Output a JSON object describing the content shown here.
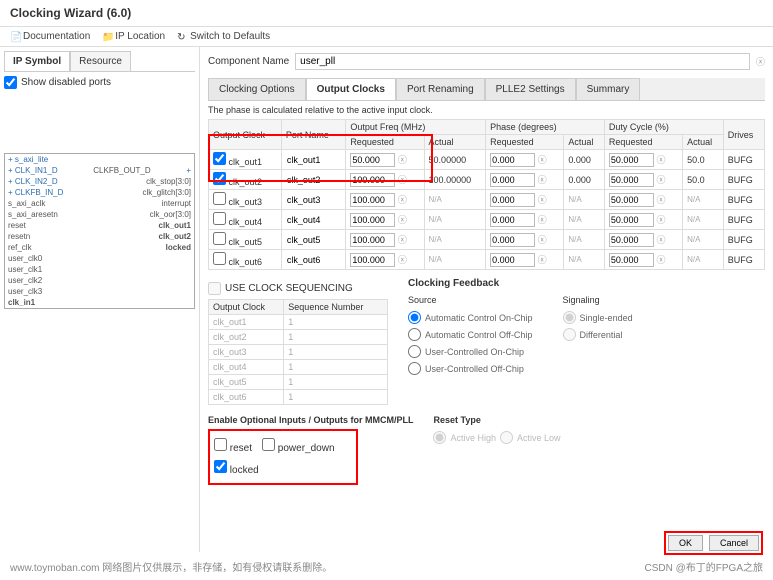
{
  "title": "Clocking Wizard (6.0)",
  "toolbar": {
    "doc": "Documentation",
    "iploc": "IP Location",
    "switch": "Switch to Defaults"
  },
  "left": {
    "tabs": {
      "ipsymbol": "IP Symbol",
      "resource": "Resource"
    },
    "show_disabled": "Show disabled ports",
    "diagram": {
      "left_ports": [
        "s_axi_lite",
        "CLK_IN1_D",
        "CLK_IN2_D",
        "CLKFB_IN_D",
        "s_axi_aclk",
        "s_axi_aresetn",
        "reset",
        "resetn",
        "ref_clk",
        "user_clk0",
        "user_clk1",
        "user_clk2",
        "user_clk3",
        "clk_in1"
      ],
      "right_ports": [
        "CLKFB_OUT_D",
        "clk_stop[3:0]",
        "clk_glitch[3:0]",
        "interrupt",
        "clk_oor[3:0]",
        "clk_out1",
        "clk_out2",
        "locked"
      ]
    }
  },
  "comp": {
    "label": "Component Name",
    "value": "user_pll"
  },
  "tabs": [
    "Clocking Options",
    "Output Clocks",
    "Port Renaming",
    "PLLE2 Settings",
    "Summary"
  ],
  "active_tab": 1,
  "note": "The phase is calculated relative to the active input clock.",
  "headers": {
    "oc": "Output Clock",
    "pn": "Port Name",
    "of": "Output Freq (MHz)",
    "req": "Requested",
    "act": "Actual",
    "ph": "Phase (degrees)",
    "dc": "Duty Cycle (%)",
    "drv": "Drives"
  },
  "rows": [
    {
      "en": true,
      "name": "clk_out1",
      "port": "clk_out1",
      "req": "50.000",
      "act": "50.00000",
      "preq": "0.000",
      "pact": "0.000",
      "dreq": "50.000",
      "dact": "50.0",
      "drv": "BUFG"
    },
    {
      "en": true,
      "name": "clk_out2",
      "port": "clk_out2",
      "req": "100.000",
      "act": "100.00000",
      "preq": "0.000",
      "pact": "0.000",
      "dreq": "50.000",
      "dact": "50.0",
      "drv": "BUFG"
    },
    {
      "en": false,
      "name": "clk_out3",
      "port": "clk_out3",
      "req": "100.000",
      "act": "N/A",
      "preq": "0.000",
      "pact": "N/A",
      "dreq": "50.000",
      "dact": "N/A",
      "drv": "BUFG"
    },
    {
      "en": false,
      "name": "clk_out4",
      "port": "clk_out4",
      "req": "100.000",
      "act": "N/A",
      "preq": "0.000",
      "pact": "N/A",
      "dreq": "50.000",
      "dact": "N/A",
      "drv": "BUFG"
    },
    {
      "en": false,
      "name": "clk_out5",
      "port": "clk_out5",
      "req": "100.000",
      "act": "N/A",
      "preq": "0.000",
      "pact": "N/A",
      "dreq": "50.000",
      "dact": "N/A",
      "drv": "BUFG"
    },
    {
      "en": false,
      "name": "clk_out6",
      "port": "clk_out6",
      "req": "100.000",
      "act": "N/A",
      "preq": "0.000",
      "pact": "N/A",
      "dreq": "50.000",
      "dact": "N/A",
      "drv": "BUFG"
    }
  ],
  "seq": {
    "use": "USE CLOCK SEQUENCING",
    "th": {
      "oc": "Output Clock",
      "sn": "Sequence Number"
    },
    "rows": [
      {
        "oc": "clk_out1",
        "sn": "1"
      },
      {
        "oc": "clk_out2",
        "sn": "1"
      },
      {
        "oc": "clk_out3",
        "sn": "1"
      },
      {
        "oc": "clk_out4",
        "sn": "1"
      },
      {
        "oc": "clk_out5",
        "sn": "1"
      },
      {
        "oc": "clk_out6",
        "sn": "1"
      }
    ]
  },
  "fb": {
    "title": "Clocking Feedback",
    "source": "Source",
    "signaling": "Signaling",
    "src_opts": [
      "Automatic Control On-Chip",
      "Automatic Control Off-Chip",
      "User-Controlled On-Chip",
      "User-Controlled Off-Chip"
    ],
    "sig_opts": [
      "Single-ended",
      "Differential"
    ]
  },
  "opt": {
    "title": "Enable Optional Inputs / Outputs for MMCM/PLL",
    "reset": "reset",
    "power_down": "power_down",
    "locked": "locked"
  },
  "rt": {
    "title": "Reset Type",
    "high": "Active High",
    "low": "Active Low"
  },
  "buttons": {
    "ok": "OK",
    "cancel": "Cancel"
  },
  "watermark": {
    "left": "www.toymoban.com  网络图片仅供展示，非存储，如有侵权请联系删除。",
    "right": "CSDN @布丁的FPGA之旅"
  }
}
